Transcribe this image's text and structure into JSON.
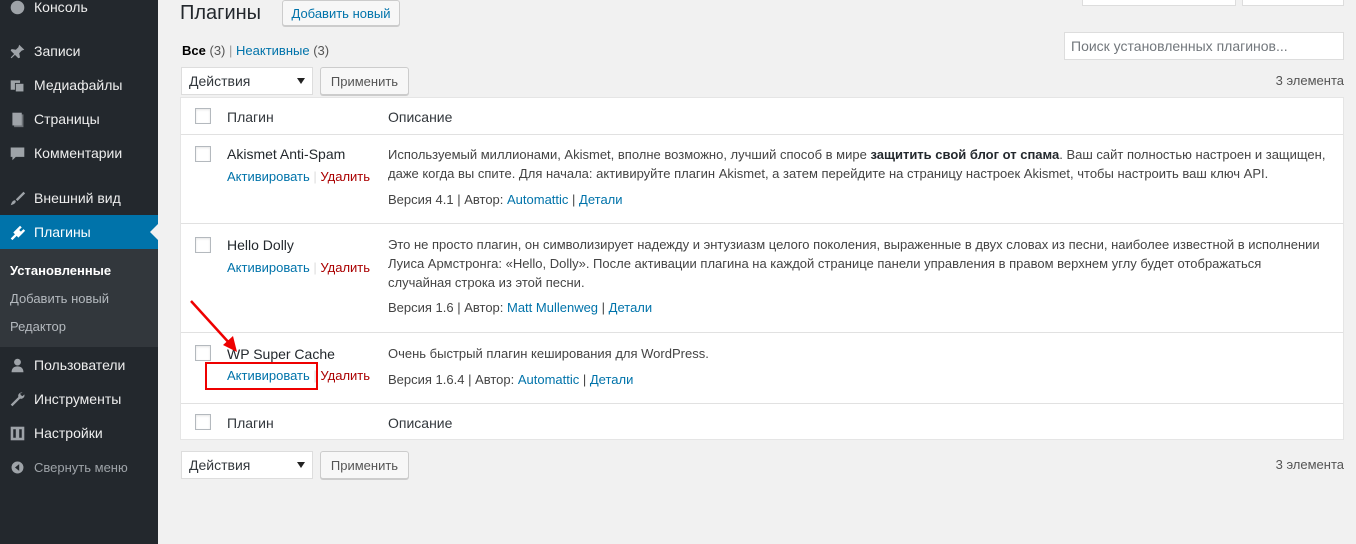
{
  "sidebar": {
    "items": [
      {
        "label": "Консоль",
        "icon": "dashboard-icon"
      },
      {
        "label": "Записи",
        "icon": "pin-icon"
      },
      {
        "label": "Медиафайлы",
        "icon": "media-icon"
      },
      {
        "label": "Страницы",
        "icon": "pages-icon"
      },
      {
        "label": "Комментарии",
        "icon": "comments-icon"
      },
      {
        "label": "Внешний вид",
        "icon": "brush-icon"
      },
      {
        "label": "Плагины",
        "icon": "plugin-icon"
      },
      {
        "label": "Пользователи",
        "icon": "users-icon"
      },
      {
        "label": "Инструменты",
        "icon": "wrench-icon"
      },
      {
        "label": "Настройки",
        "icon": "settings-icon"
      }
    ],
    "submenu": [
      "Установленные",
      "Добавить новый",
      "Редактор"
    ],
    "collapse_label": "Свернуть меню"
  },
  "header": {
    "title": "Плагины",
    "add_new": "Добавить новый"
  },
  "filters": {
    "all_label": "Все",
    "all_count": "(3)",
    "sep": "|",
    "inactive_label": "Неактивные",
    "inactive_count": "(3)"
  },
  "search": {
    "placeholder": "Поиск установленных плагинов..."
  },
  "bulk": {
    "select_value": "Действия",
    "apply_label": "Применить",
    "count": "3 элемента"
  },
  "table": {
    "col_name": "Плагин",
    "col_desc": "Описание",
    "rows": [
      {
        "name": "Akismet Anti-Spam",
        "activate": "Активировать",
        "delete": "Удалить",
        "desc_before": "Используемый миллионами, Akismet, вполне возможно, лучший способ в мире ",
        "desc_bold": "защитить свой блог от спама",
        "desc_after": ". Ваш сайт полностью настроен и защищен, даже когда вы спите. Для начала: активируйте плагин Akismet, а затем перейдите на страницу настроек Akismet, чтобы настроить ваш ключ API.",
        "version": "Версия 4.1 | Автор: ",
        "author": "Automattic",
        "details": "Детали"
      },
      {
        "name": "Hello Dolly",
        "activate": "Активировать",
        "delete": "Удалить",
        "desc": "Это не просто плагин, он символизирует надежду и энтузиазм целого поколения, выраженные в двух словах из песни, наиболее известной в исполнении Луиса Армстронга: «Hello, Dolly». После активации плагина на каждой странице панели управления в правом верхнем углу будет отображаться случайная строка из этой песни.",
        "version": "Версия 1.6 | Автор: ",
        "author": "Matt Mullenweg",
        "details": "Детали"
      },
      {
        "name": "WP Super Cache",
        "activate": "Активировать",
        "delete": "Удалить",
        "desc": "Очень быстрый плагин кеширования для WordPress.",
        "version": "Версия 1.6.4 | Автор: ",
        "author": "Automattic",
        "details": "Детали"
      }
    ]
  },
  "colors": {
    "sidebar_bg": "#23282d",
    "active_bg": "#0073aa",
    "link": "#0073aa",
    "delete": "#a00",
    "annotation": "#e00"
  }
}
